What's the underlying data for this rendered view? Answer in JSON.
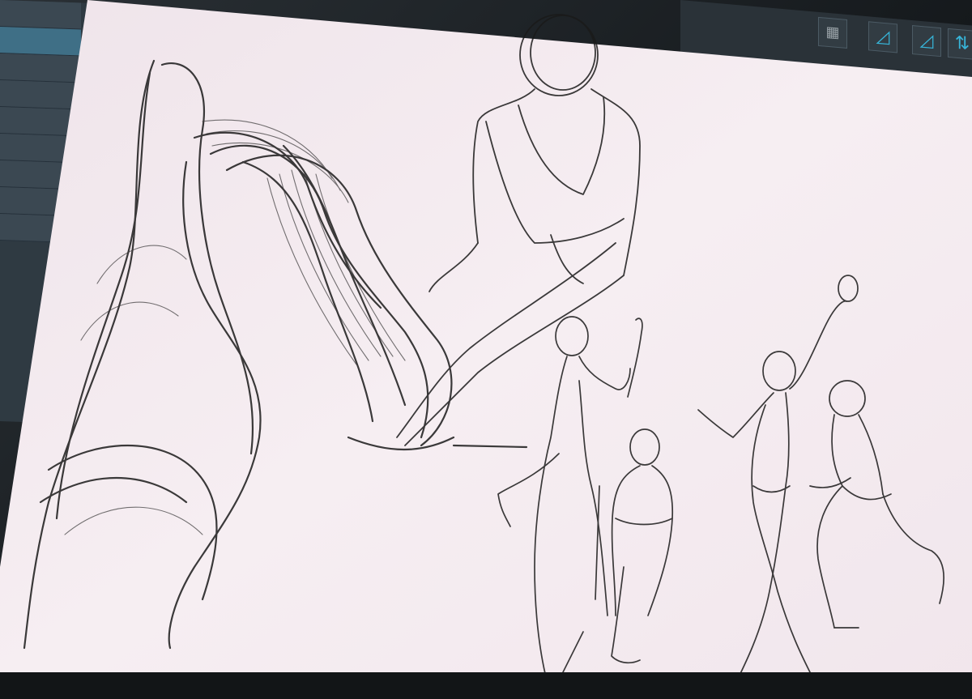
{
  "scene": {
    "description_kind": "photo of drawing tablet screen",
    "colors": {
      "paper": "#f3e9ef",
      "ink": "#1a1a1a",
      "panel": "#2f3a42",
      "accent": "#37b4d8"
    }
  },
  "toolbar": {
    "icons": [
      "filmstrip-icon",
      "ruler-tool-icon",
      "ruler-tool-icon",
      "symmetry-tool-icon"
    ]
  },
  "side_panel": {
    "rows": 9
  }
}
